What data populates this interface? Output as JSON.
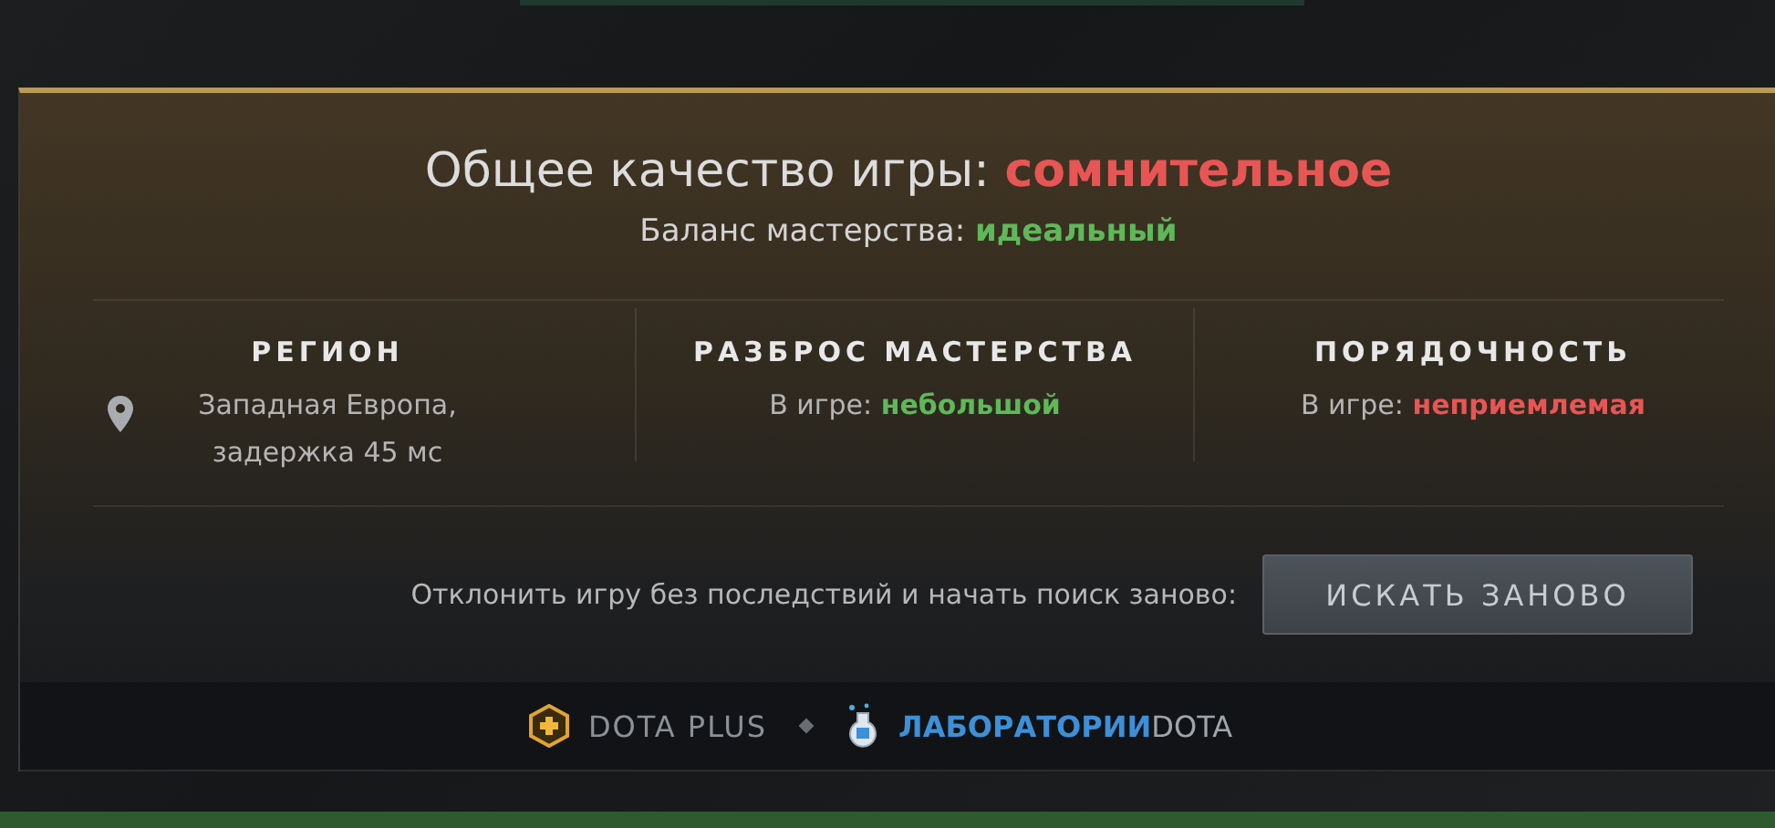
{
  "quality": {
    "label": "Общее качество игры:",
    "value": "сомнительное",
    "color": "#e85555"
  },
  "balance": {
    "label": "Баланс мастерства:",
    "value": "идеальный",
    "color": "#5fb85a"
  },
  "columns": [
    {
      "kind": "region",
      "title": "РЕГИОН",
      "lines": [
        "Западная Европа,",
        "задержка 45 мс"
      ]
    },
    {
      "kind": "rating",
      "title": "РАЗБРОС МАСТЕРСТВА",
      "label": "В игре:",
      "value": "небольшой",
      "color": "#5fb85a"
    },
    {
      "kind": "rating",
      "title": "ПОРЯДОЧНОСТЬ",
      "label": "В игре:",
      "value": "неприемлемая",
      "color": "#e85555"
    }
  ],
  "decline": {
    "text": "Отклонить игру без последствий и начать поиск заново:",
    "button": "ИСКАТЬ ЗАНОВО"
  },
  "footer": {
    "plus": "DOTA PLUS",
    "labs": "**ЛАБОРАТОРИИ**DOTA"
  }
}
